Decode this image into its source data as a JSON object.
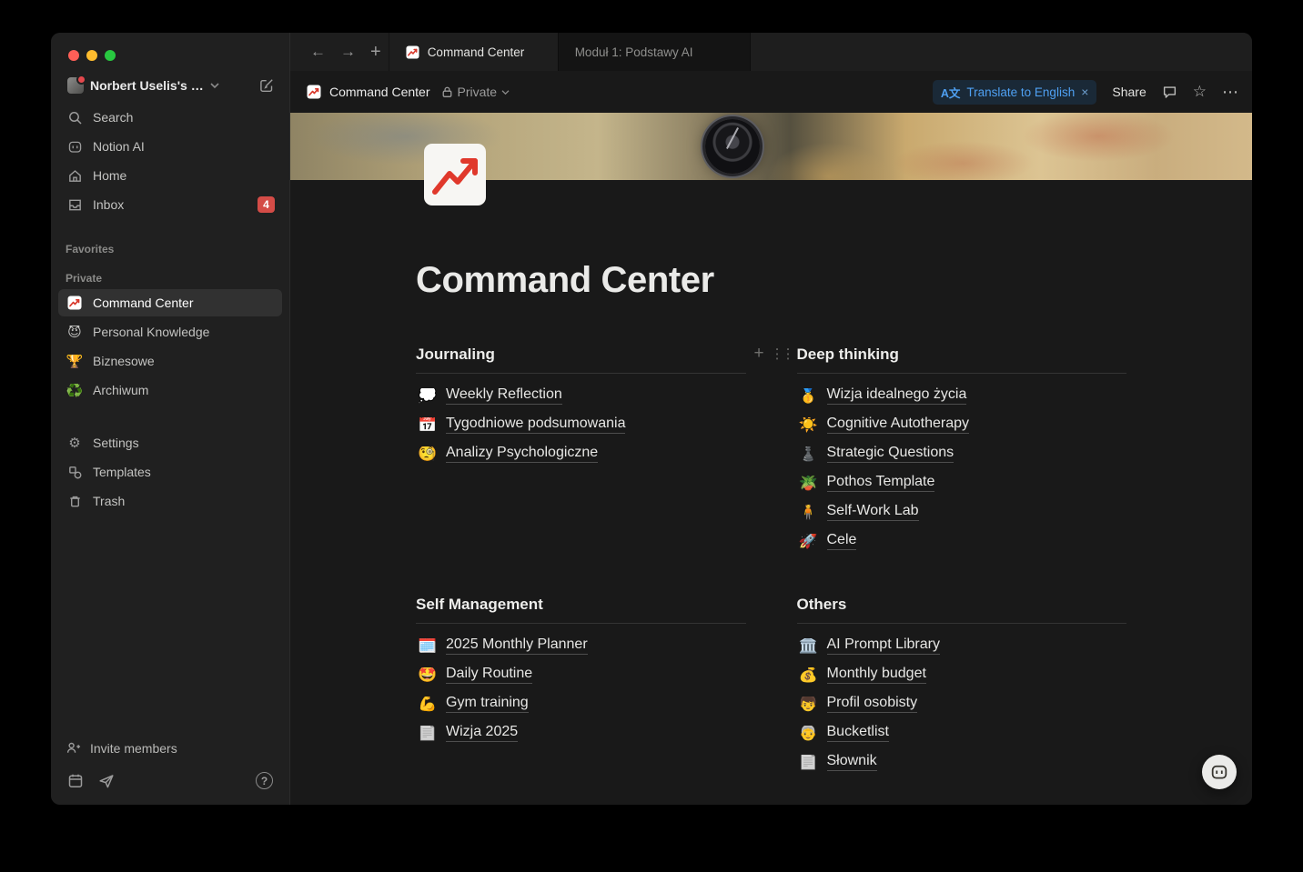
{
  "colors": {
    "accent_blue": "#2383e2",
    "badge_red": "#d44c47",
    "sidebar_bg": "#202020",
    "main_bg": "#191919",
    "chart_red": "#d8382b"
  },
  "sidebar": {
    "workspace": {
      "name": "Norbert Uselis's …"
    },
    "nav": [
      {
        "icon": "search-icon",
        "label": "Search"
      },
      {
        "icon": "notion-ai-icon",
        "label": "Notion AI"
      },
      {
        "icon": "home-icon",
        "label": "Home"
      },
      {
        "icon": "inbox-icon",
        "label": "Inbox",
        "badge": "4"
      }
    ],
    "section_labels": {
      "favorites": "Favorites",
      "private": "Private"
    },
    "private_items": [
      {
        "emoji": "📈",
        "label": "Command Center",
        "selected": true
      },
      {
        "emoji": "😈",
        "label": "Personal Knowledge"
      },
      {
        "emoji": "🏆",
        "label": "Biznesowe"
      },
      {
        "emoji": "♻️",
        "label": "Archiwum"
      }
    ],
    "system_items": [
      {
        "icon": "gear-icon",
        "label": "Settings"
      },
      {
        "icon": "templates-icon",
        "label": "Templates"
      },
      {
        "icon": "trash-icon",
        "label": "Trash"
      }
    ],
    "invite_label": "Invite members"
  },
  "tabbar": {
    "tabs": [
      {
        "label": "Command Center",
        "active": true
      },
      {
        "label": "Moduł 1: Podstawy AI",
        "active": false
      }
    ]
  },
  "header": {
    "breadcrumb_title": "Command Center",
    "privacy_label": "Private",
    "translate": {
      "icon": "A文",
      "label": "Translate to English",
      "close": "×"
    },
    "share_label": "Share"
  },
  "page": {
    "title": "Command Center",
    "sections": [
      {
        "title": "Journaling",
        "items": [
          {
            "emoji": "💭",
            "label": "Weekly Reflection"
          },
          {
            "emoji": "📅",
            "label": "Tygodniowe podsumowania"
          },
          {
            "emoji": "🧐",
            "label": "Analizy Psychologiczne"
          }
        ]
      },
      {
        "title": "Deep thinking",
        "items": [
          {
            "emoji": "🥇",
            "label": "Wizja idealnego życia"
          },
          {
            "emoji": "☀️",
            "label": "Cognitive Autotherapy"
          },
          {
            "emoji": "♟️",
            "label": "Strategic Questions"
          },
          {
            "emoji": "🪴",
            "label": "Pothos Template"
          },
          {
            "emoji": "🧍",
            "label": "Self-Work Lab"
          },
          {
            "emoji": "🚀",
            "label": "Cele"
          }
        ]
      },
      {
        "title": "Self Management",
        "items": [
          {
            "emoji": "🗓️",
            "label": "2025 Monthly Planner"
          },
          {
            "emoji": "🤩",
            "label": "Daily Routine"
          },
          {
            "emoji": "💪",
            "label": "Gym training"
          },
          {
            "emoji": "📄",
            "label": "Wizja 2025"
          }
        ]
      },
      {
        "title": "Others",
        "items": [
          {
            "emoji": "🏛️",
            "label": "AI Prompt Library"
          },
          {
            "emoji": "💰",
            "label": "Monthly budget"
          },
          {
            "emoji": "👦",
            "label": "Profil osobisty"
          },
          {
            "emoji": "👵",
            "label": "Bucketlist"
          },
          {
            "emoji": "📄",
            "label": "Słownik"
          }
        ]
      }
    ]
  }
}
